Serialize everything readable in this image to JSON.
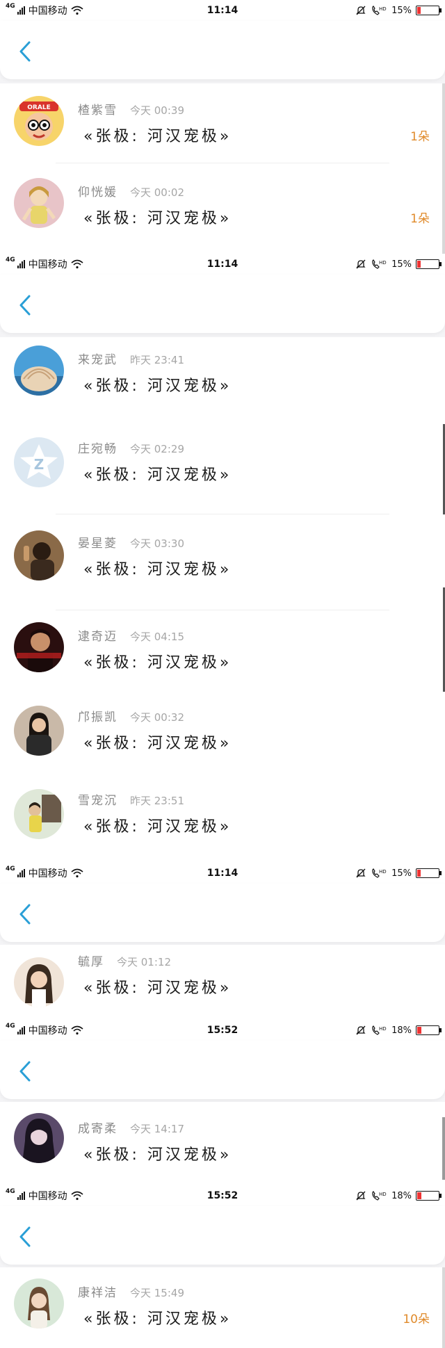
{
  "colors": {
    "accent": "#2a9fd6",
    "badge": "#e08a2a",
    "battery_low": "#e33333"
  },
  "segments": [
    {
      "status": {
        "carrier": "中国移动",
        "network": "4G",
        "time": "11:14",
        "battery": "15%",
        "battery_level": 0.15,
        "icons": [
          "signal-icon",
          "wifi-icon",
          "mute-icon",
          "hd-call-icon",
          "battery-icon"
        ]
      },
      "back_label": "back-arrow",
      "rows": [
        {
          "name": "楂紫雪",
          "time": "今天 00:39",
          "message": "«张极: 河汉宠极»",
          "badge": "1朵"
        },
        {
          "name": "仰恍媛",
          "time": "今天 00:02",
          "message": "«张极: 河汉宠极»",
          "badge": "1朵"
        }
      ]
    },
    {
      "status": {
        "carrier": "中国移动",
        "network": "4G",
        "time": "11:14",
        "battery": "15%",
        "battery_level": 0.15
      },
      "rows": [
        {
          "name": "来宠武",
          "time": "昨天 23:41",
          "message": "«张极: 河汉宠极»",
          "badge": ""
        },
        {
          "name": "庄宛畅",
          "time": "今天 02:29",
          "message": "«张极: 河汉宠极»",
          "badge": ""
        },
        {
          "name": "晏星菱",
          "time": "今天 03:30",
          "message": "«张极: 河汉宠极»",
          "badge": ""
        },
        {
          "name": "逮奇迈",
          "time": "今天 04:15",
          "message": "«张极: 河汉宠极»",
          "badge": ""
        },
        {
          "name": "邝振凯",
          "time": "今天 00:32",
          "message": "«张极: 河汉宠极»",
          "badge": ""
        },
        {
          "name": "雪宠沉",
          "time": "昨天 23:51",
          "message": "«张极: 河汉宠极»",
          "badge": ""
        }
      ]
    },
    {
      "status": {
        "carrier": "中国移动",
        "network": "4G",
        "time": "11:14",
        "battery": "15%",
        "battery_level": 0.15
      },
      "rows": [
        {
          "name": "毓厚",
          "time": "今天 01:12",
          "message": "«张极: 河汉宠极»",
          "badge": ""
        }
      ]
    },
    {
      "status": {
        "carrier": "中国移动",
        "network": "4G",
        "time": "15:52",
        "battery": "18%",
        "battery_level": 0.18
      },
      "rows": [
        {
          "name": "成寄柔",
          "time": "今天 14:17",
          "message": "«张极: 河汉宠极»",
          "badge": ""
        }
      ]
    },
    {
      "status": {
        "carrier": "中国移动",
        "network": "4G",
        "time": "15:52",
        "battery": "18%",
        "battery_level": 0.18
      },
      "rows": [
        {
          "name": "康祥洁",
          "time": "今天 15:49",
          "message": "«张极: 河汉宠极»",
          "badge": "10朵"
        }
      ]
    }
  ]
}
